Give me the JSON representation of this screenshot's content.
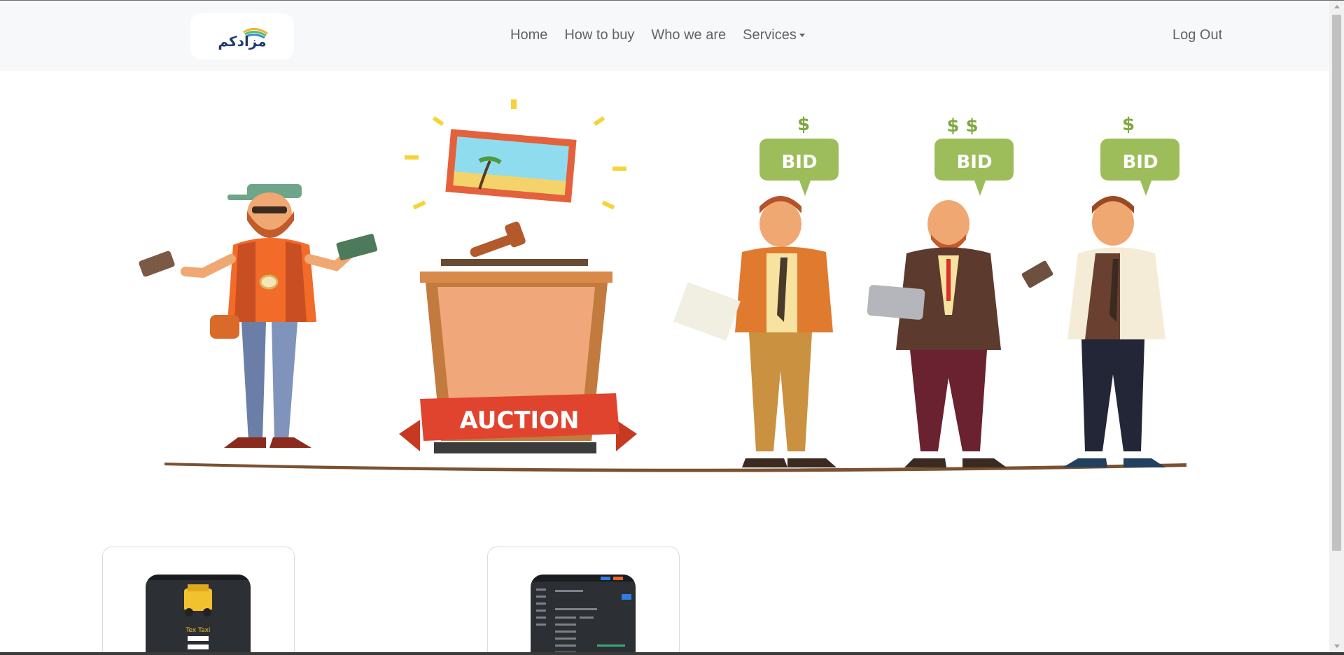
{
  "brand": {
    "logo_text": "مزادكم"
  },
  "nav": {
    "items": [
      {
        "label": "Home"
      },
      {
        "label": "How to buy"
      },
      {
        "label": "Who we are"
      },
      {
        "label": "Services"
      }
    ],
    "logout_label": "Log Out"
  },
  "hero": {
    "sign_label": "AUCTION",
    "bubbles": [
      "BID",
      "BID",
      "BID"
    ]
  },
  "cards": [
    {
      "app_label": "Tex Taxi"
    },
    {
      "app_label": ""
    }
  ],
  "colors": {
    "navbar_bg": "#f7f8f9",
    "nav_text": "#5f6468",
    "bid_green": "#9cbd5a",
    "auction_red": "#d9432c"
  }
}
